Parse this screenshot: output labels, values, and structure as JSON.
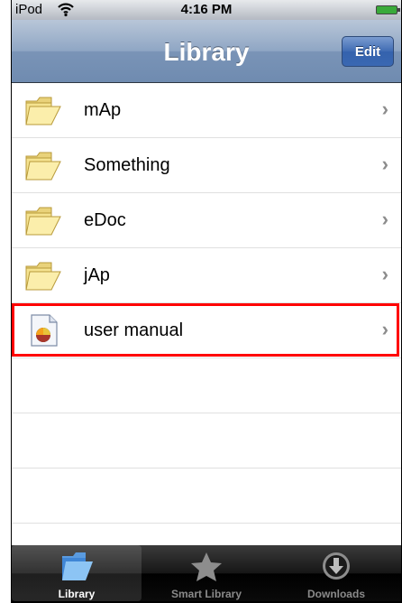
{
  "status_bar": {
    "carrier": "iPod",
    "time": "4:16 PM"
  },
  "nav_bar": {
    "title": "Library",
    "edit_label": "Edit"
  },
  "list": {
    "items": [
      {
        "label": "mAp",
        "icon": "folder-icon"
      },
      {
        "label": "Something",
        "icon": "folder-icon"
      },
      {
        "label": "eDoc",
        "icon": "folder-icon"
      },
      {
        "label": "jAp",
        "icon": "folder-icon"
      },
      {
        "label": "user manual",
        "icon": "document-icon",
        "highlighted": true
      }
    ]
  },
  "tab_bar": {
    "tabs": [
      {
        "label": "Library",
        "icon": "folder-icon",
        "active": true
      },
      {
        "label": "Smart Library",
        "icon": "star-icon",
        "active": false
      },
      {
        "label": "Downloads",
        "icon": "download-icon",
        "active": false
      }
    ]
  },
  "colors": {
    "nav_bar": "#7a94b7",
    "edit_button": "#3f6bb3",
    "highlight": "#ff0000",
    "tab_bar": "#000000"
  }
}
